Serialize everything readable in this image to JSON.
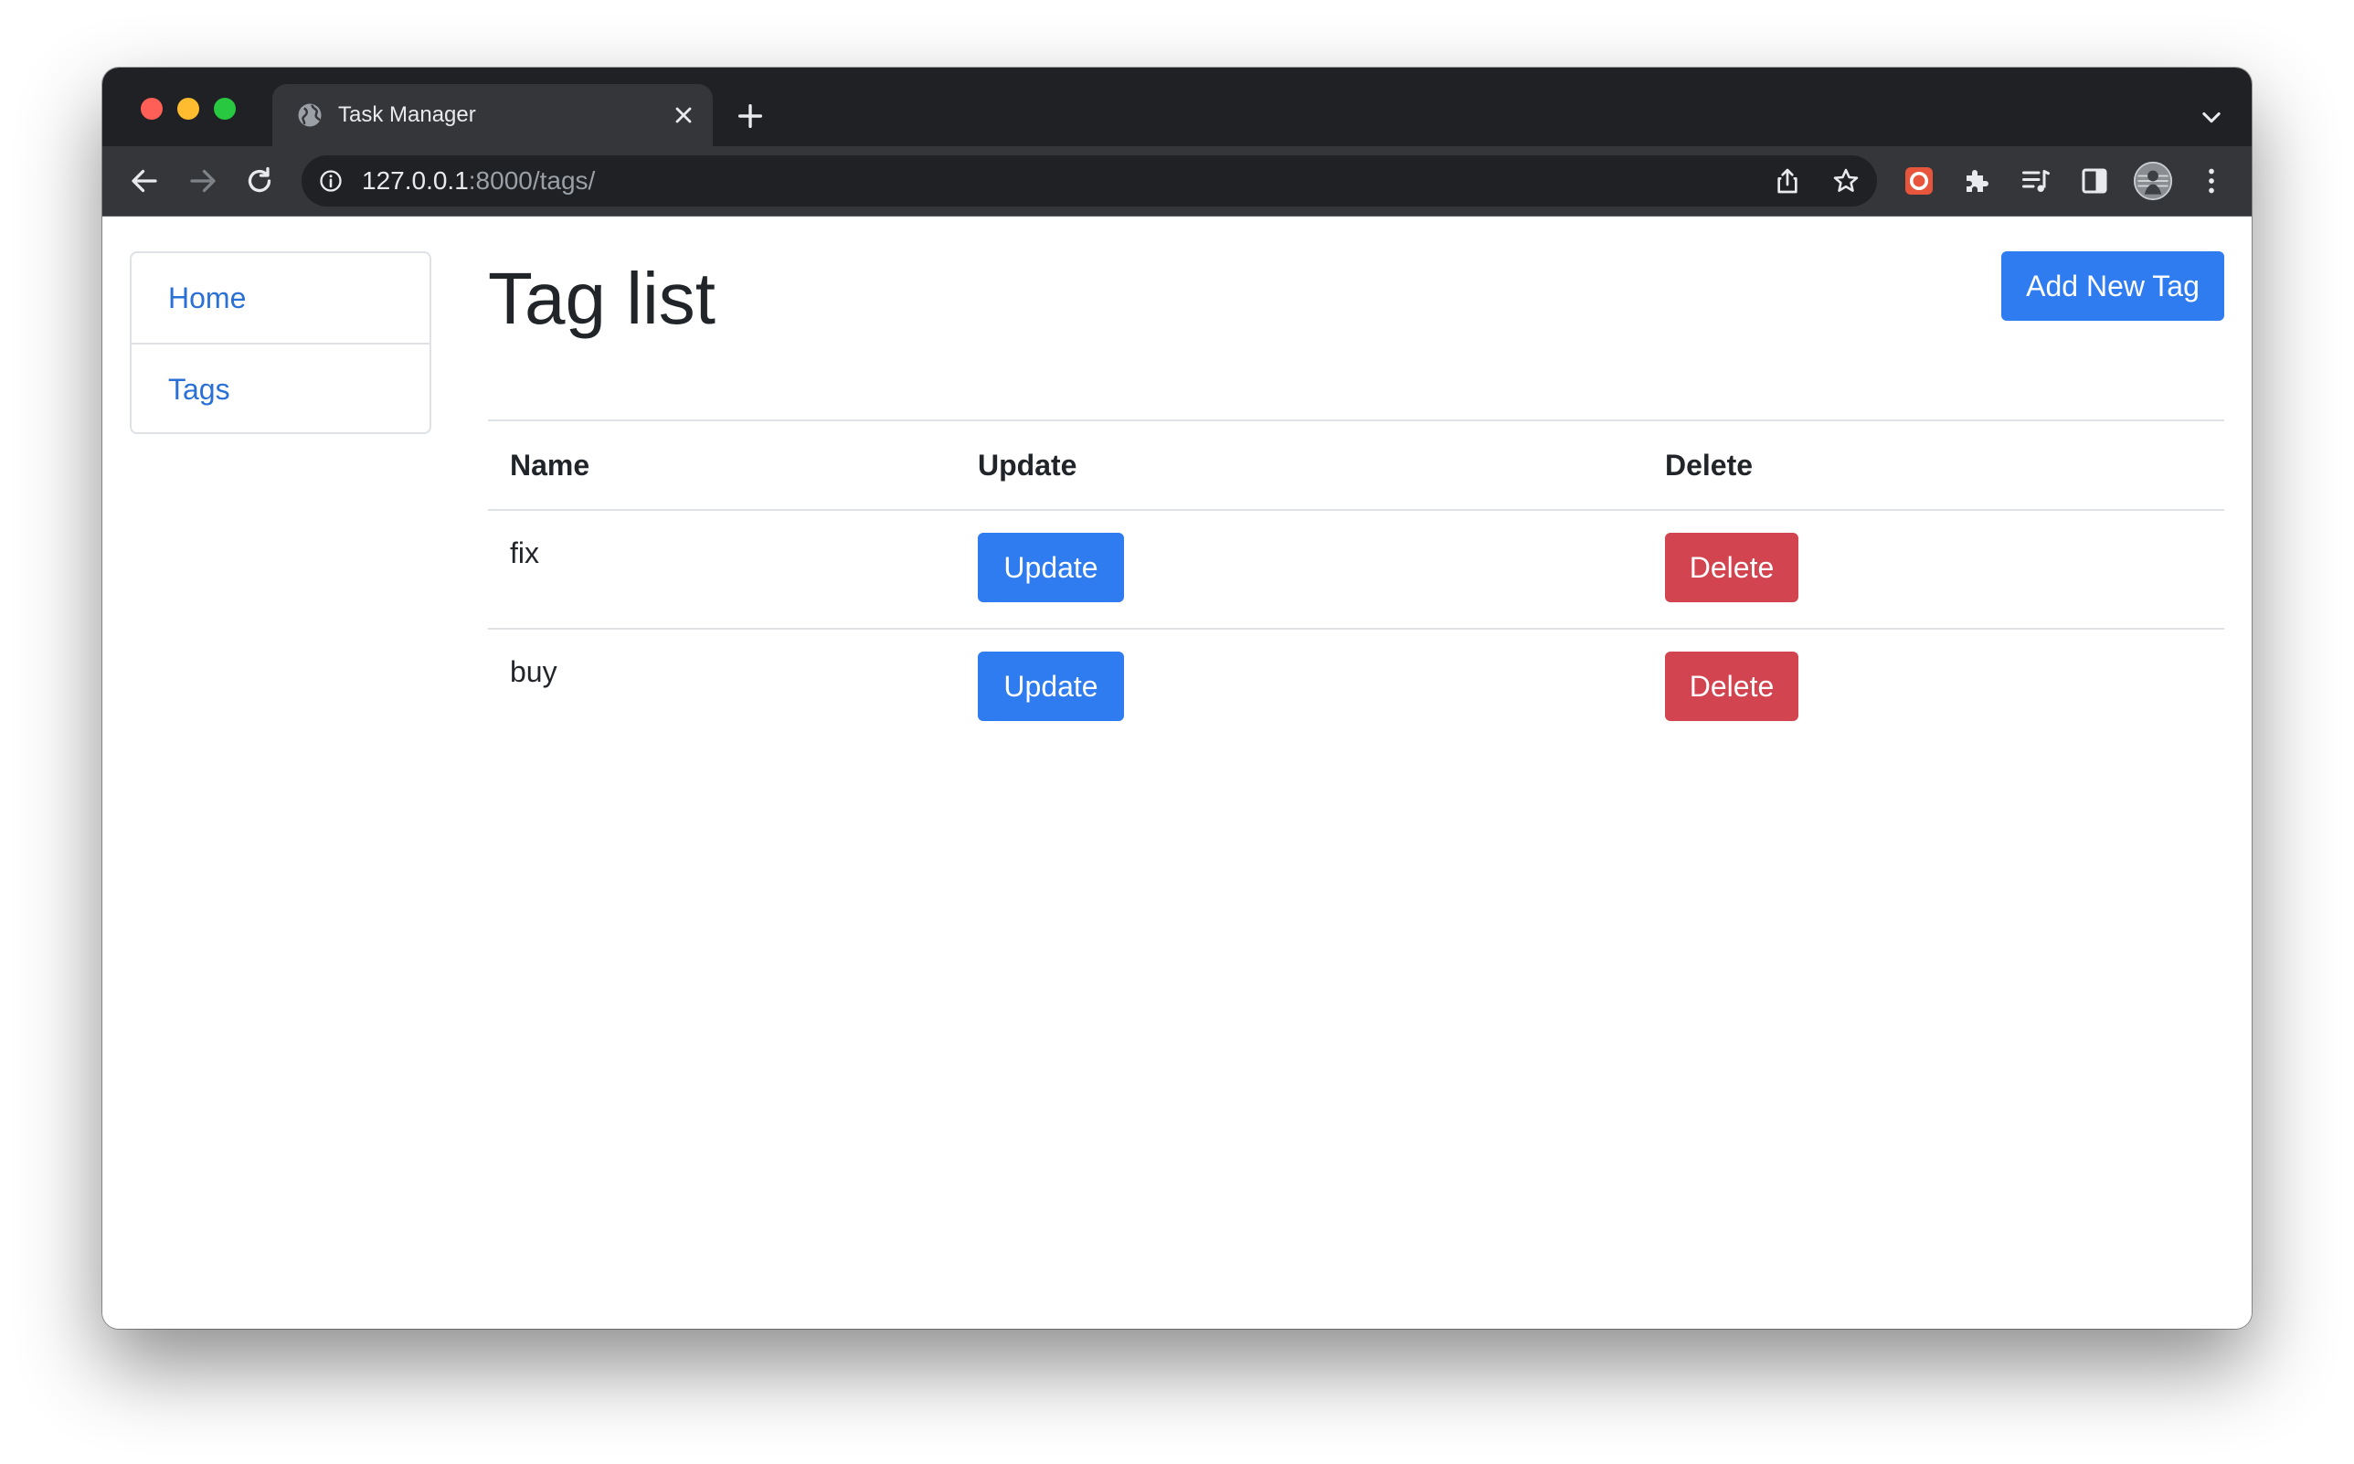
{
  "browser": {
    "tab_title": "Task Manager",
    "url_host": "127.0.0.1",
    "url_rest": ":8000/tags/"
  },
  "sidebar": {
    "items": [
      {
        "label": "Home"
      },
      {
        "label": "Tags"
      }
    ]
  },
  "main": {
    "title": "Tag list",
    "add_button_label": "Add New Tag",
    "table": {
      "headers": [
        "Name",
        "Update",
        "Delete"
      ],
      "rows": [
        {
          "name": "fix",
          "update_label": "Update",
          "delete_label": "Delete"
        },
        {
          "name": "buy",
          "update_label": "Update",
          "delete_label": "Delete"
        }
      ]
    }
  },
  "colors": {
    "primary": "#2f7cf0",
    "danger": "#d2444f",
    "link": "#2a70d6",
    "browser_chrome": "#35363a"
  },
  "icons": [
    "globe-icon",
    "close-icon",
    "plus-icon",
    "chevron-down-icon",
    "back-arrow-icon",
    "forward-arrow-icon",
    "reload-icon",
    "info-icon",
    "share-icon",
    "star-icon",
    "extension-red-icon",
    "puzzle-icon",
    "media-control-icon",
    "side-panel-icon",
    "profile-avatar-icon",
    "more-menu-icon"
  ]
}
